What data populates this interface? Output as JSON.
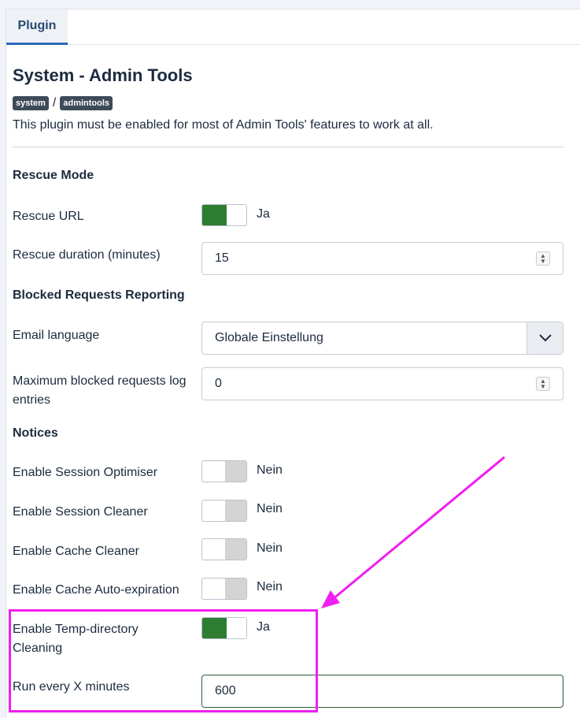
{
  "tabs": [
    {
      "label": "Plugin"
    }
  ],
  "plugin": {
    "title": "System - Admin Tools",
    "tags": [
      "system",
      "admintools"
    ],
    "tag_separator": "/",
    "description": "This plugin must be enabled for most of Admin Tools' features to work at all."
  },
  "sections": {
    "rescue_mode": "Rescue Mode",
    "blocked_requests": "Blocked Requests Reporting",
    "notices": "Notices"
  },
  "fields": {
    "rescue_url": {
      "label": "Rescue URL",
      "state": "Ja"
    },
    "rescue_duration": {
      "label": "Rescue duration (minutes)",
      "value": "15"
    },
    "email_language": {
      "label": "Email language",
      "value": "Globale Einstellung"
    },
    "max_blocked_log": {
      "label": "Maximum blocked requests log entries",
      "value": "0"
    },
    "session_optimiser": {
      "label": "Enable Session Optimiser",
      "state": "Nein"
    },
    "session_cleaner": {
      "label": "Enable Session Cleaner",
      "state": "Nein"
    },
    "cache_cleaner": {
      "label": "Enable Cache Cleaner",
      "state": "Nein"
    },
    "cache_autoexpiration": {
      "label": "Enable Cache Auto-expiration",
      "state": "Nein"
    },
    "temp_cleaning": {
      "label": "Enable Temp-directory Cleaning",
      "state": "Ja"
    },
    "run_every": {
      "label": "Run every X minutes",
      "value": "600"
    }
  },
  "colors": {
    "toggle_on": "#2e7d32",
    "toggle_off": "#d4d4d4",
    "annotation": "#f01ef0",
    "tab_accent": "#2a69b8"
  }
}
